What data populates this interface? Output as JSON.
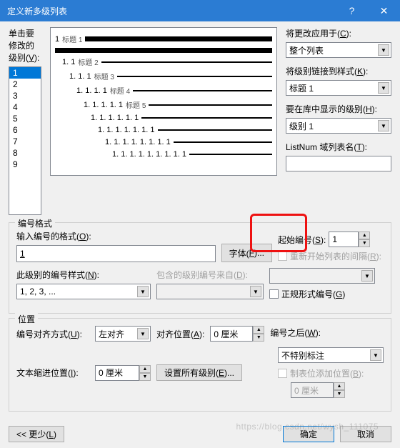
{
  "titlebar": {
    "title": "定义新多级列表"
  },
  "left": {
    "level_label_pre": "单击要修改的级别(",
    "level_label_key": "V",
    "level_label_post": "):",
    "levels": [
      "1",
      "2",
      "3",
      "4",
      "5",
      "6",
      "7",
      "8",
      "9"
    ],
    "selected_index": 0
  },
  "preview": [
    {
      "indent": 0,
      "num": "1",
      "lbl": "标题 1",
      "thick": true
    },
    {
      "indent": 0,
      "num": "",
      "lbl": "",
      "thick": true
    },
    {
      "indent": 1,
      "num": "1. 1",
      "lbl": "标题 2"
    },
    {
      "indent": 2,
      "num": "1. 1. 1",
      "lbl": "标题 3"
    },
    {
      "indent": 3,
      "num": "1. 1. 1. 1",
      "lbl": "标题 4"
    },
    {
      "indent": 4,
      "num": "1. 1. 1. 1. 1",
      "lbl": "标题 5"
    },
    {
      "indent": 5,
      "num": "1. 1. 1. 1. 1. 1"
    },
    {
      "indent": 6,
      "num": "1. 1. 1. 1. 1. 1. 1"
    },
    {
      "indent": 7,
      "num": "1. 1. 1. 1. 1. 1. 1. 1"
    },
    {
      "indent": 8,
      "num": "1. 1. 1. 1. 1. 1. 1. 1. 1"
    }
  ],
  "right": {
    "apply_label_pre": "将更改应用于(",
    "apply_key": "C",
    "apply_post": "):",
    "apply_value": "整个列表",
    "link_label_pre": "将级别链接到样式(",
    "link_key": "K",
    "link_post": "):",
    "link_value": "标题 1",
    "gallery_label_pre": "要在库中显示的级别(",
    "gallery_key": "H",
    "gallery_post": "):",
    "gallery_value": "级别 1",
    "listnum_label_pre": "ListNum 域列表名(",
    "listnum_key": "T",
    "listnum_post": "):",
    "listnum_value": ""
  },
  "numfmt": {
    "legend": "编号格式",
    "format_label_pre": "输入编号的格式(",
    "format_key": "O",
    "format_post": "):",
    "format_value": "1",
    "font_btn_pre": "字体(",
    "font_key": "F",
    "font_post": ")...",
    "style_label_pre": "此级别的编号样式(",
    "style_key": "N",
    "style_post": "):",
    "style_value": "1, 2, 3, ...",
    "include_label_pre": "包含的级别编号来自(",
    "include_key": "D",
    "include_post": "):",
    "start_label_pre": "起始编号(",
    "start_key": "S",
    "start_post": "):",
    "start_value": "1",
    "restart_pre": "重新开始列表的间隔(",
    "restart_key": "R",
    "restart_post": "):",
    "legal_pre": "正规形式编号(",
    "legal_key": "G",
    "legal_post": ")"
  },
  "pos": {
    "legend": "位置",
    "align_label_pre": "编号对齐方式(",
    "align_key": "U",
    "align_post": "):",
    "align_value": "左对齐",
    "alignat_label_pre": "对齐位置(",
    "alignat_key": "A",
    "alignat_post": "):",
    "alignat_value": "0 厘米",
    "indent_label_pre": "文本缩进位置(",
    "indent_key": "I",
    "indent_post": "):",
    "indent_value": "0 厘米",
    "setall_pre": "设置所有级别(",
    "setall_key": "E",
    "setall_post": ")...",
    "follow_label_pre": "编号之后(",
    "follow_key": "W",
    "follow_post": "):",
    "follow_value": "不特别标注",
    "tab_pre": "制表位添加位置(",
    "tab_key": "B",
    "tab_post": "):",
    "tab_value": "0 厘米"
  },
  "footer": {
    "less_pre": "<< 更少(",
    "less_key": "L",
    "less_post": ")",
    "ok": "确定",
    "cancel": "取消"
  },
  "watermark": "https://blog.csdn.net/wysh_111075"
}
